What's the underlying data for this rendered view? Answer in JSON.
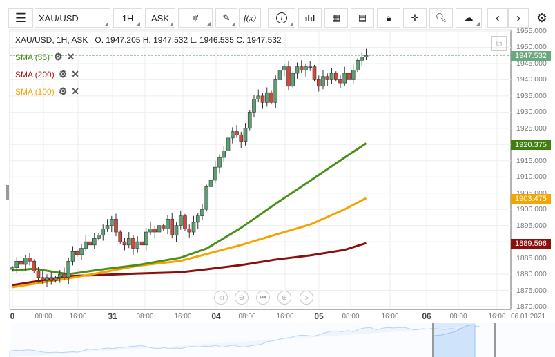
{
  "toolbar": {
    "symbol": "XAU/USD",
    "interval": "1H",
    "price_type": "ASK",
    "fx_label": "f(x)"
  },
  "header": {
    "info": "XAU/USD, 1H, ASK   O. 1947.205 H. 1947.532 L. 1946.535 C. 1947.532"
  },
  "legend": [
    {
      "label": "SMA (55)",
      "color": "#4a8f1a"
    },
    {
      "label": "SMA (200)",
      "color": "#a01c1c"
    },
    {
      "label": "SMA (100)",
      "color": "#f5a300"
    }
  ],
  "price_tags": [
    {
      "value": "1947.532",
      "color": "#6aa87d"
    },
    {
      "value": "1920.375",
      "color": "#3f7f10"
    },
    {
      "value": "1903.475",
      "color": "#f5a300"
    },
    {
      "value": "1889.596",
      "color": "#8b0f0f"
    }
  ],
  "chart_data": {
    "type": "candlestick",
    "y_ticks": [
      "1955.000",
      "1950.000",
      "1945.000",
      "1940.000",
      "1935.000",
      "1930.000",
      "1925.000",
      "1920.000",
      "1915.000",
      "1910.000",
      "1905.000",
      "1900.000",
      "1895.000",
      "1890.000",
      "1885.000",
      "1880.000",
      "1875.000",
      "1870.000"
    ],
    "ylim": [
      1870,
      1955
    ],
    "x_labels": [
      {
        "t": "0",
        "bold": true
      },
      {
        "t": "08:00"
      },
      {
        "t": "16:00"
      },
      {
        "t": "31",
        "bold": true
      },
      {
        "t": "08:00"
      },
      {
        "t": "16:00"
      },
      {
        "t": "04",
        "bold": true
      },
      {
        "t": "08:00"
      },
      {
        "t": "16:00"
      },
      {
        "t": "05",
        "bold": true
      },
      {
        "t": "08:00"
      },
      {
        "t": "16:00"
      },
      {
        "t": "06",
        "bold": true
      },
      {
        "t": "08:00"
      },
      {
        "t": "16:00"
      },
      {
        "t": "06.01.2021"
      }
    ],
    "closes": [
      1882,
      1884,
      1883,
      1885,
      1884,
      1881,
      1879,
      1878,
      1879,
      1878,
      1879,
      1880,
      1879,
      1884,
      1887,
      1886,
      1888,
      1890,
      1889,
      1891,
      1892,
      1894,
      1895,
      1897,
      1893,
      1890,
      1889,
      1891,
      1888,
      1890,
      1889,
      1893,
      1894,
      1893,
      1895,
      1894,
      1897,
      1892,
      1895,
      1898,
      1894,
      1893,
      1896,
      1898,
      1900,
      1907,
      1909,
      1913,
      1916,
      1918,
      1922,
      1924,
      1923,
      1921,
      1925,
      1930,
      1934,
      1935,
      1933,
      1936,
      1933,
      1940,
      1943,
      1944,
      1938,
      1942,
      1944,
      1943,
      1944,
      1944,
      1940,
      1938,
      1941,
      1940,
      1942,
      1940,
      1939,
      1942,
      1940,
      1943,
      1946,
      1947,
      1947.532
    ],
    "sma55": [
      [
        0,
        1881.1
      ],
      [
        5,
        1881.7
      ],
      [
        13,
        1880.0
      ],
      [
        21,
        1881.5
      ],
      [
        29,
        1882.8
      ],
      [
        39,
        1885.1
      ],
      [
        45,
        1887.9
      ],
      [
        53,
        1894.3
      ],
      [
        61,
        1901.7
      ],
      [
        69,
        1908.8
      ],
      [
        77,
        1916.0
      ],
      [
        82,
        1920.375
      ]
    ],
    "sma100": [
      [
        0,
        1876.0
      ],
      [
        13,
        1878.7
      ],
      [
        21,
        1880.6
      ],
      [
        29,
        1882.6
      ],
      [
        39,
        1884.1
      ],
      [
        45,
        1886.2
      ],
      [
        53,
        1889.0
      ],
      [
        61,
        1892.2
      ],
      [
        69,
        1895.3
      ],
      [
        77,
        1900.0
      ],
      [
        82,
        1903.475
      ]
    ],
    "sma200": [
      [
        0,
        1876.6
      ],
      [
        13,
        1879.4
      ],
      [
        21,
        1879.8
      ],
      [
        29,
        1880.2
      ],
      [
        39,
        1880.6
      ],
      [
        45,
        1881.5
      ],
      [
        53,
        1882.8
      ],
      [
        61,
        1884.5
      ],
      [
        69,
        1885.8
      ],
      [
        77,
        1887.5
      ],
      [
        82,
        1889.596
      ]
    ],
    "last": 1947.532
  }
}
